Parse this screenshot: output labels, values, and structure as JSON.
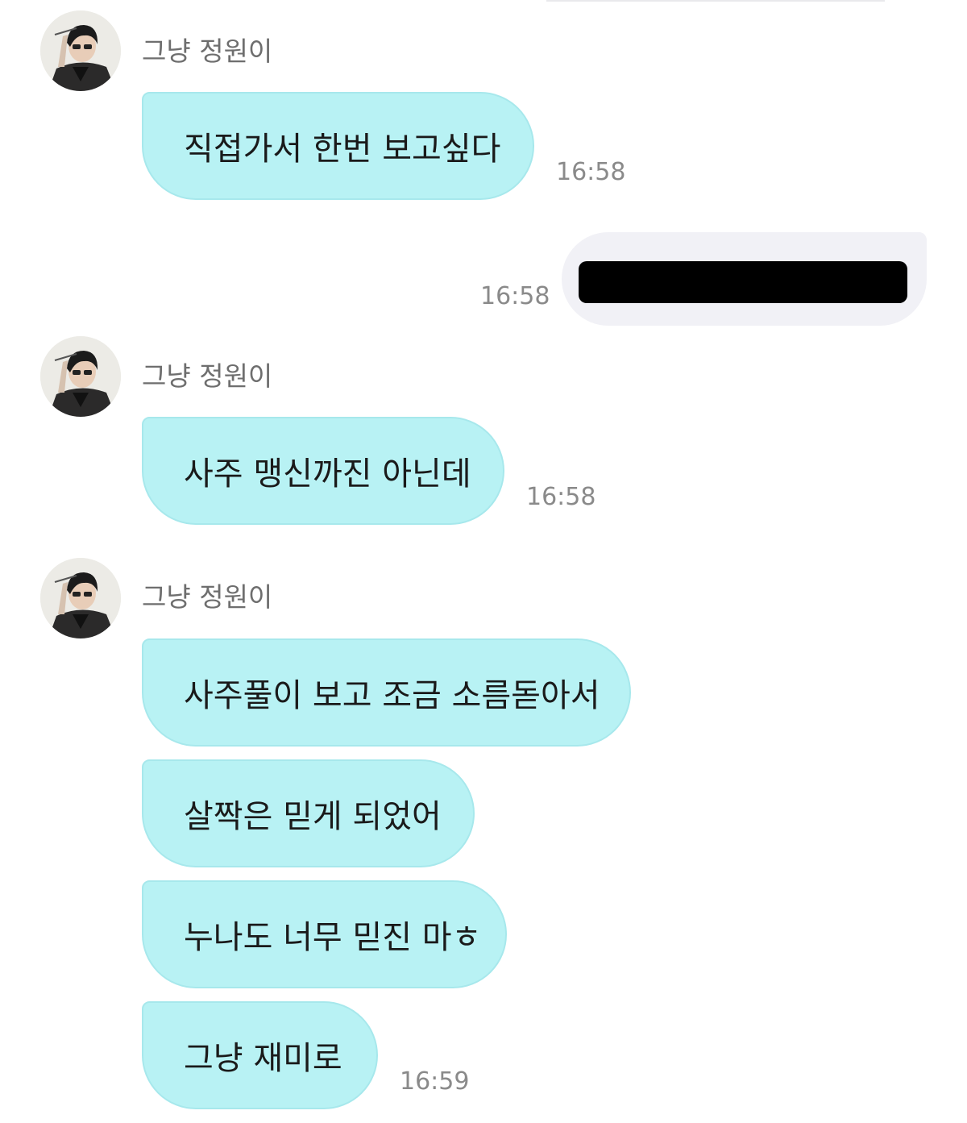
{
  "chat": {
    "sender_name": "그냥 정원이",
    "groups": [
      {
        "sender": "그냥 정원이",
        "messages": [
          {
            "text": "직접가서 한번 보고싶다",
            "time": "16:58"
          }
        ]
      },
      {
        "sender": "me",
        "messages": [
          {
            "text": "",
            "redacted": true,
            "time": "16:58"
          }
        ]
      },
      {
        "sender": "그냥 정원이",
        "messages": [
          {
            "text": "사주 맹신까진 아닌데",
            "time": "16:58"
          }
        ]
      },
      {
        "sender": "그냥 정원이",
        "messages": [
          {
            "text": "사주풀이 보고 조금 소름돋아서"
          },
          {
            "text": "살짝은 믿게 되었어"
          },
          {
            "text": "누나도 너무 믿진 마ㅎ"
          },
          {
            "text": "그냥 재미로",
            "time": "16:59"
          }
        ]
      }
    ]
  },
  "colors": {
    "incoming_bubble": "#b8f2f4",
    "outgoing_bubble": "#f1f1f6",
    "timestamp": "#8a8a8a",
    "sender_name": "#6e6e6e"
  },
  "icons": {
    "avatar": "profile-photo"
  }
}
